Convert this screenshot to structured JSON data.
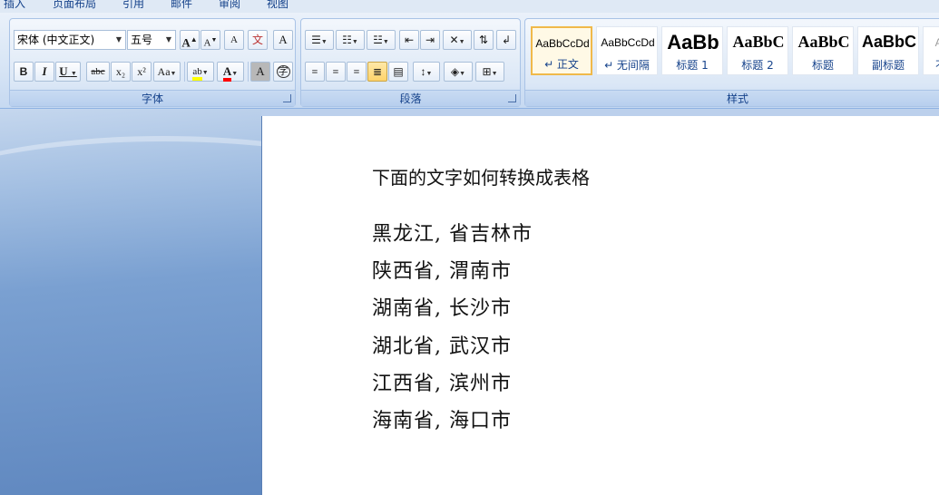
{
  "tabs": [
    "插入",
    "页面布局",
    "引用",
    "邮件",
    "审阅",
    "视图"
  ],
  "font_group": {
    "label": "字体",
    "font_name": "宋体 (中文正文)",
    "font_size": "五号",
    "grow_glyph": "A",
    "shrink_glyph": "A",
    "clear_glyph": "A",
    "phonetic_glyph": "文",
    "border_glyph": "A",
    "bold_glyph": "B",
    "italic_glyph": "I",
    "underline_glyph": "U",
    "strike_glyph": "abc",
    "sub_glyph": "x₂",
    "sup_glyph": "x²",
    "case_glyph": "Aa",
    "highlight_glyph": "ab",
    "color_glyph": "A",
    "shading_glyph": "A",
    "enclose_glyph": "字",
    "highlight_color": "#ffff00",
    "font_color": "#ff0000"
  },
  "paragraph_group": {
    "label": "段落"
  },
  "styles_group": {
    "label": "样式",
    "styles": [
      {
        "sample": "AaBbCcDd",
        "name": "↵ 正文"
      },
      {
        "sample": "AaBbCcDd",
        "name": "↵ 无间隔"
      },
      {
        "sample": "AaBb",
        "name": "标题 1"
      },
      {
        "sample": "AaBbC",
        "name": "标题 2"
      },
      {
        "sample": "AaBbC",
        "name": "标题"
      },
      {
        "sample": "AaBbC",
        "name": "副标题"
      },
      {
        "sample": "Aa",
        "name": "不"
      }
    ]
  },
  "document": {
    "title": "下面的文字如何转换成表格",
    "lines": [
      "黑龙江, 省吉林市",
      "陕西省, 渭南市",
      "湖南省, 长沙市",
      "湖北省, 武汉市",
      "江西省, 滨州市",
      "海南省, 海口市"
    ]
  },
  "colors": {
    "ribbon_text": "#15428b",
    "selected_style_border": "#f0b94a"
  }
}
